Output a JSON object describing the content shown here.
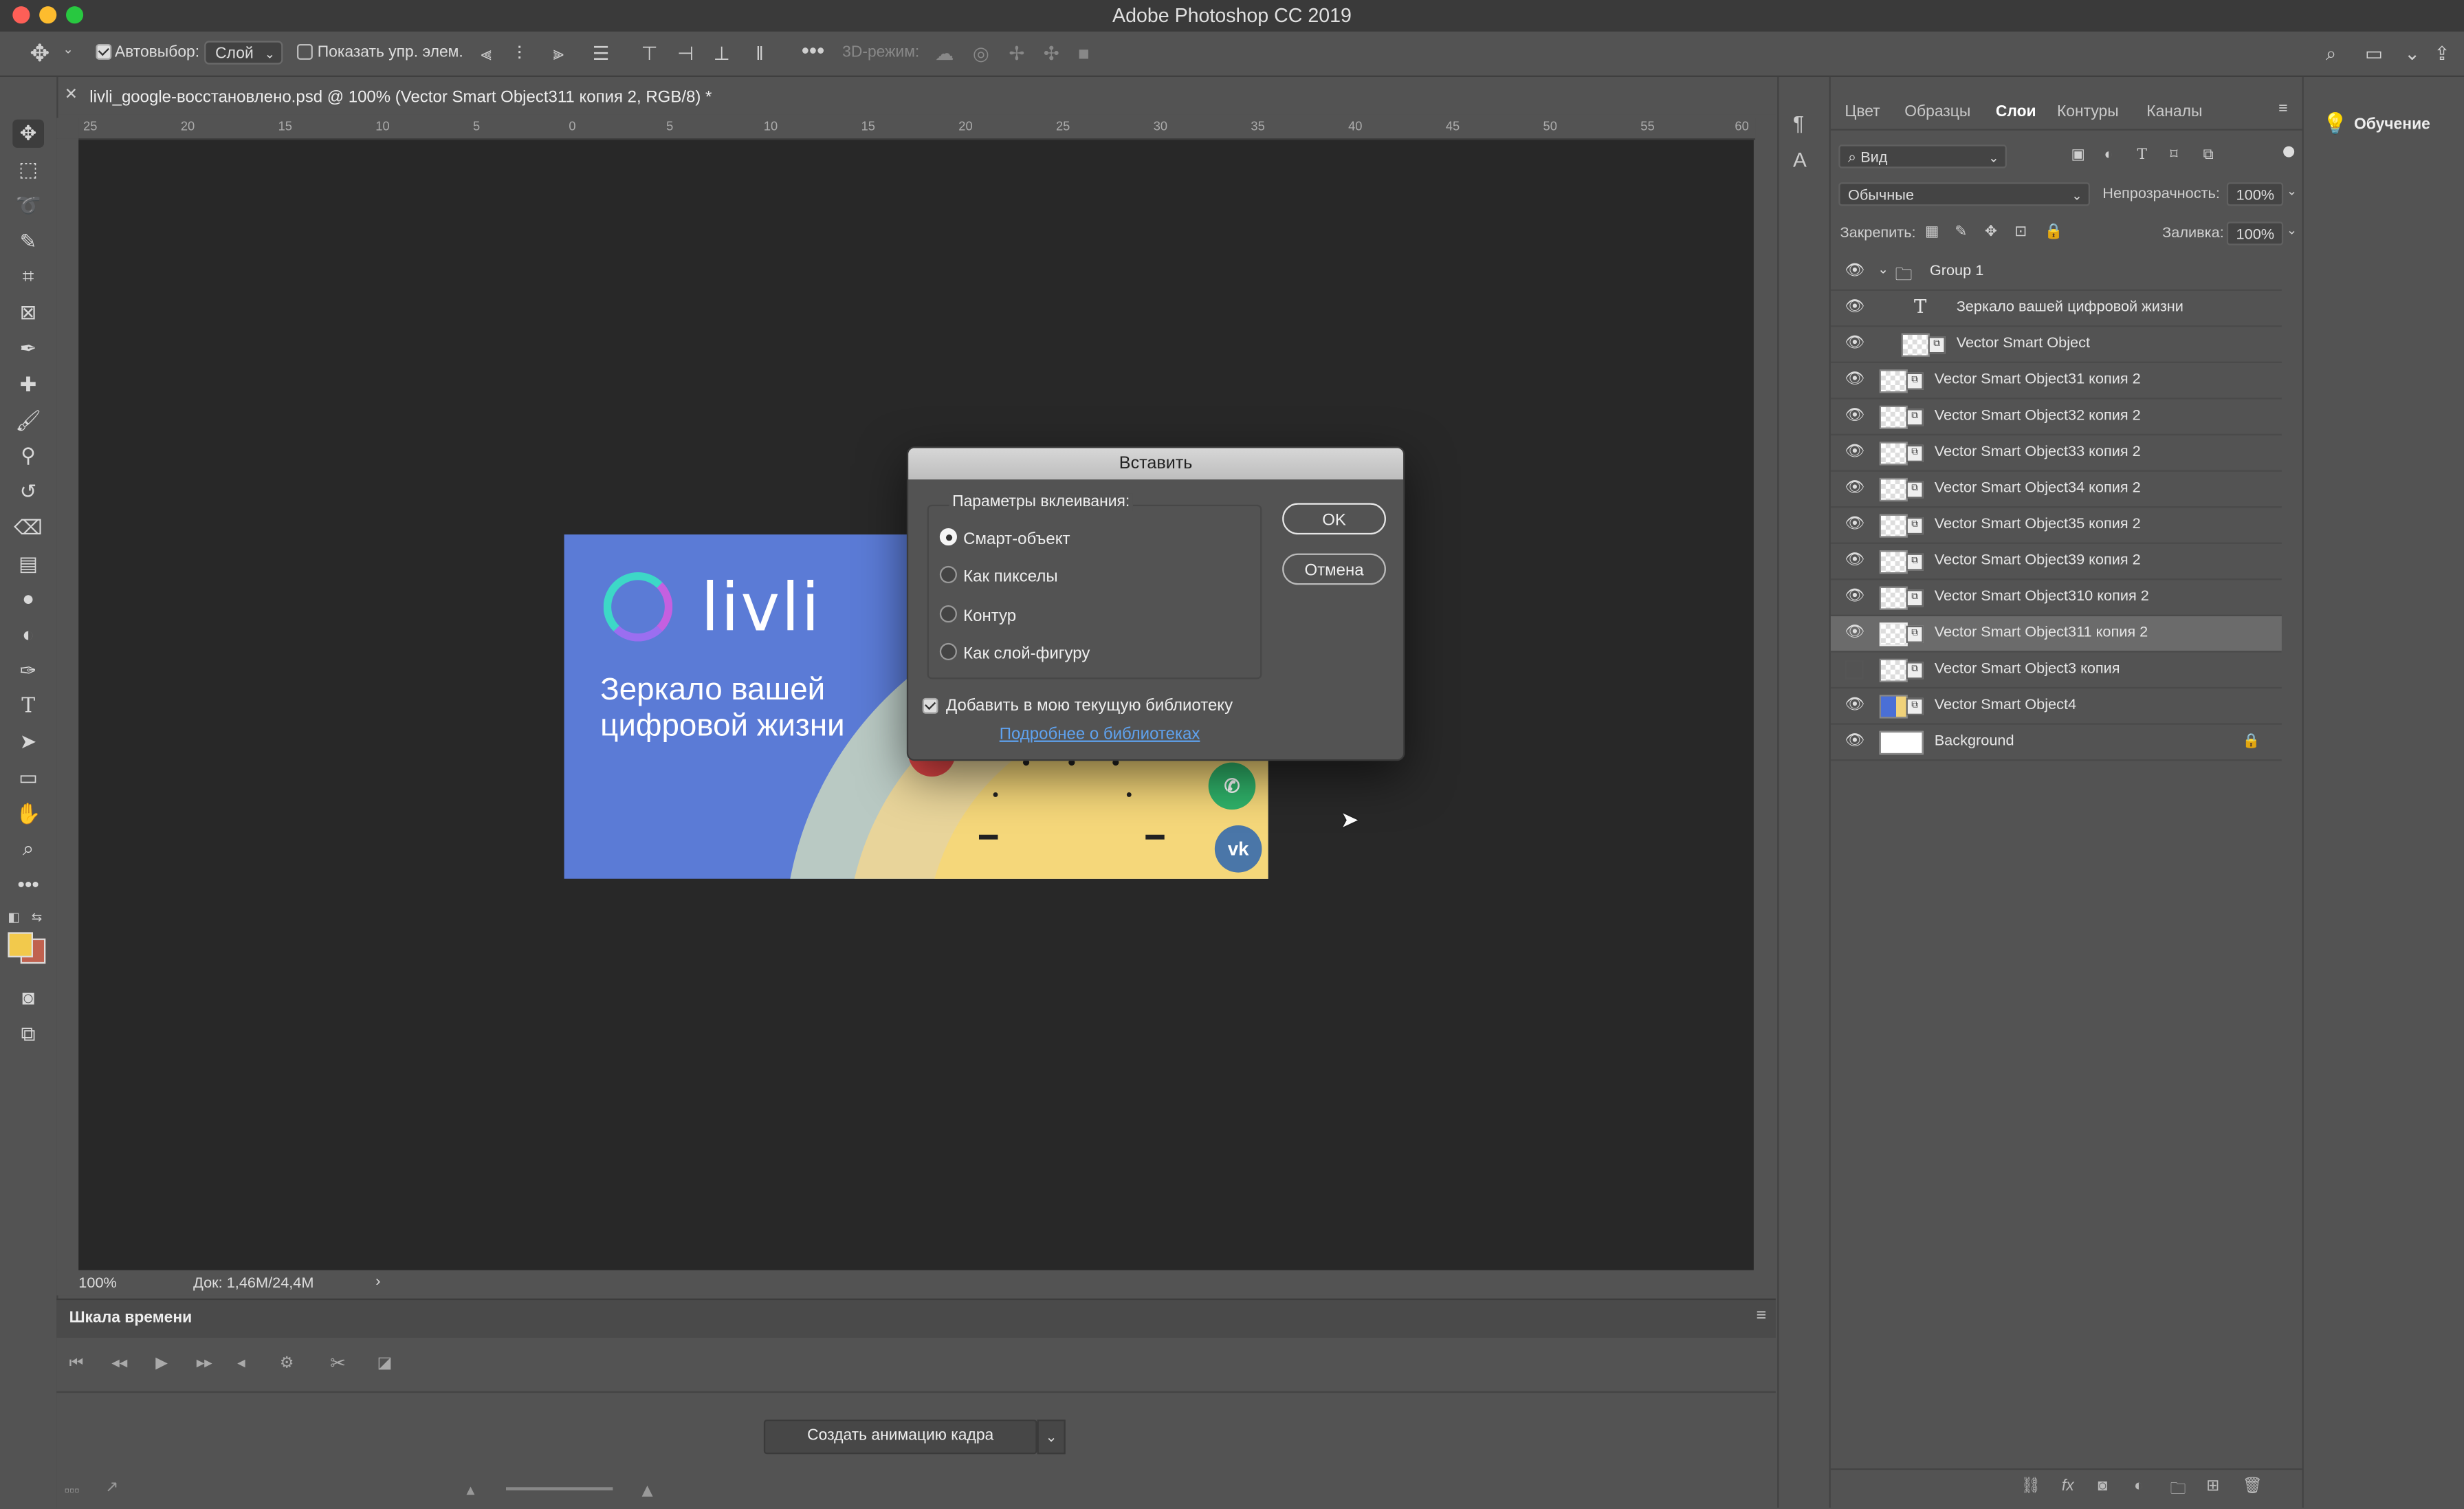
{
  "app": {
    "title": "Adobe Photoshop CC 2019"
  },
  "options_bar": {
    "autoselect_label": "Автовыбор:",
    "autoselect_value": "Слой",
    "show_transform_label": "Показать упр. элем.",
    "mode_3d_label": "3D-режим:"
  },
  "document": {
    "tab_title": "livli_google-восстановлено.psd @ 100% (Vector Smart Object311 копия 2, RGB/8) *",
    "ruler_ticks": [
      "25",
      "20",
      "15",
      "10",
      "5",
      "0",
      "5",
      "10",
      "15",
      "20",
      "25",
      "30",
      "35",
      "40",
      "45",
      "50",
      "55",
      "60"
    ],
    "zoom": "100%",
    "doc_size": "Док: 1,46M/24,4M"
  },
  "artwork": {
    "logo_text": "livli",
    "tagline": "Зеркало вашей цифровой жизни",
    "social": [
      "whatsapp",
      "vk"
    ]
  },
  "timeline": {
    "title": "Шкала времени",
    "create_button": "Создать анимацию кадра"
  },
  "panel": {
    "tabs": [
      "Цвет",
      "Образцы",
      "Слои",
      "Контуры",
      "Каналы"
    ],
    "selected_tab": "Слои",
    "filter_kind": "Вид",
    "blend_mode": "Обычные",
    "opacity_label": "Непрозрачность:",
    "opacity_value": "100%",
    "lock_label": "Закрепить:",
    "fill_label": "Заливка:",
    "fill_value": "100%",
    "layers": [
      {
        "name": "Group 1",
        "type": "group",
        "visible": true
      },
      {
        "name": "Зеркало вашей  цифровой жизни",
        "type": "text",
        "visible": true
      },
      {
        "name": "Vector Smart Object",
        "type": "smart",
        "visible": true
      },
      {
        "name": "Vector Smart Object31 копия 2",
        "type": "smart",
        "visible": true
      },
      {
        "name": "Vector Smart Object32 копия 2",
        "type": "smart",
        "visible": true
      },
      {
        "name": "Vector Smart Object33 копия 2",
        "type": "smart",
        "visible": true
      },
      {
        "name": "Vector Smart Object34 копия 2",
        "type": "smart",
        "visible": true
      },
      {
        "name": "Vector Smart Object35 копия 2",
        "type": "smart",
        "visible": true
      },
      {
        "name": "Vector Smart Object39 копия 2",
        "type": "smart",
        "visible": true
      },
      {
        "name": "Vector Smart Object310 копия 2",
        "type": "smart",
        "visible": true
      },
      {
        "name": "Vector Smart Object311 копия 2",
        "type": "smart",
        "visible": true,
        "selected": true
      },
      {
        "name": "Vector Smart Object3 копия",
        "type": "smart",
        "visible": false
      },
      {
        "name": "Vector Smart Object4",
        "type": "smart",
        "visible": true
      },
      {
        "name": "Background",
        "type": "background",
        "visible": true,
        "locked": true
      }
    ]
  },
  "learn_panel": {
    "label": "Обучение"
  },
  "dialog": {
    "title": "Вставить",
    "group_label": "Параметры вклеивания:",
    "options": [
      "Смарт-объект",
      "Как пикселы",
      "Контур",
      "Как слой-фигуру"
    ],
    "selected_option": "Смарт-объект",
    "ok": "OK",
    "cancel": "Отмена",
    "library_checkbox": "Добавить в мою текущую библиотеку",
    "library_checked": true,
    "library_link": "Подробнее о библиотеках"
  }
}
